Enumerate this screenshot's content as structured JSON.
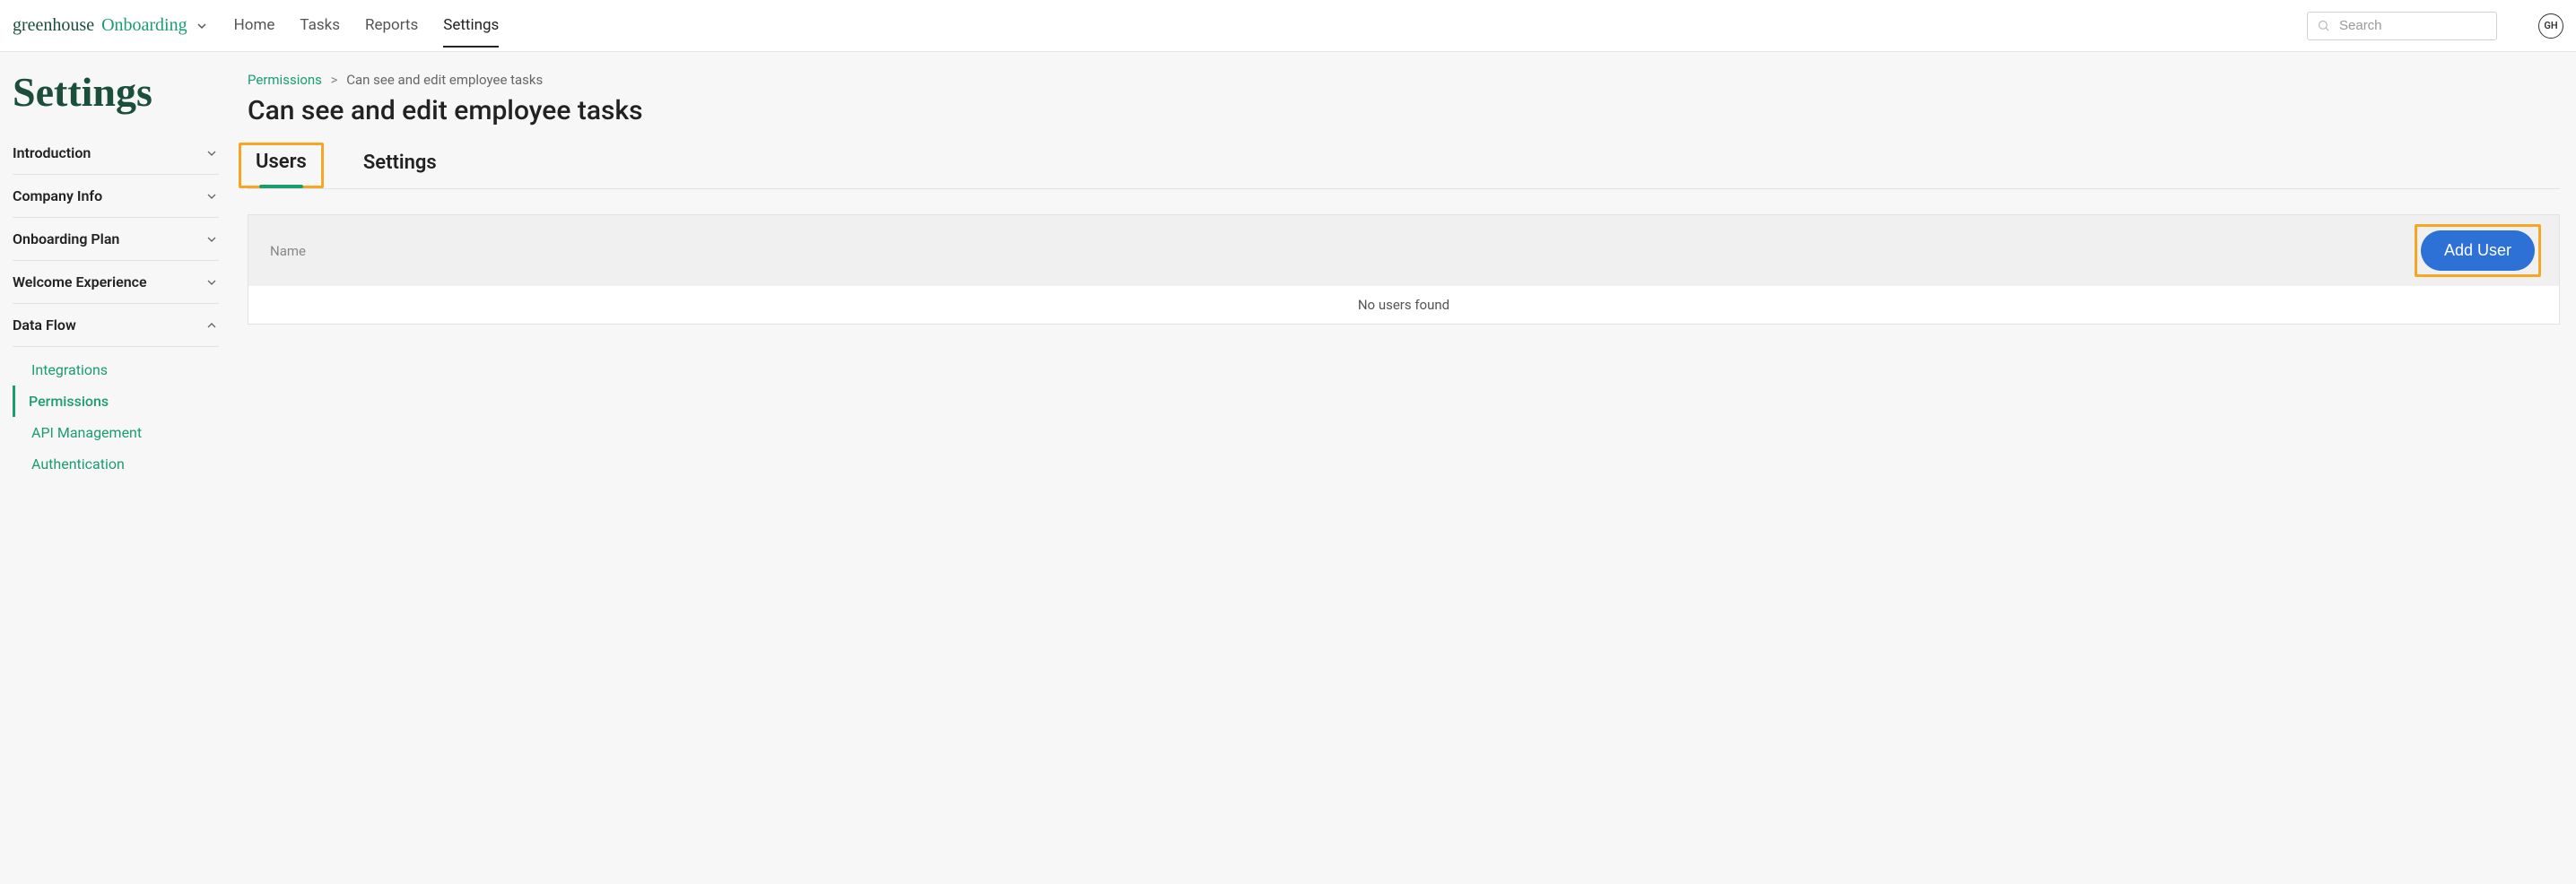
{
  "brand": {
    "main": "greenhouse",
    "sub": "Onboarding"
  },
  "nav": {
    "items": [
      {
        "label": "Home",
        "active": false
      },
      {
        "label": "Tasks",
        "active": false
      },
      {
        "label": "Reports",
        "active": false
      },
      {
        "label": "Settings",
        "active": true
      }
    ]
  },
  "search": {
    "placeholder": "Search"
  },
  "avatar": {
    "initials": "GH"
  },
  "page_title": "Settings",
  "sidebar": {
    "sections": [
      {
        "label": "Introduction",
        "open": false
      },
      {
        "label": "Company Info",
        "open": false
      },
      {
        "label": "Onboarding Plan",
        "open": false
      },
      {
        "label": "Welcome Experience",
        "open": false
      },
      {
        "label": "Data Flow",
        "open": true,
        "items": [
          {
            "label": "Integrations",
            "active": false
          },
          {
            "label": "Permissions",
            "active": true
          },
          {
            "label": "API Management",
            "active": false
          },
          {
            "label": "Authentication",
            "active": false
          }
        ]
      }
    ]
  },
  "breadcrumb": {
    "root": "Permissions",
    "sep": ">",
    "leaf": "Can see and edit employee tasks"
  },
  "main_title": "Can see and edit employee tasks",
  "tabs": [
    {
      "label": "Users",
      "active": true
    },
    {
      "label": "Settings",
      "active": false
    }
  ],
  "table": {
    "header": "Name",
    "add_button": "Add User",
    "empty": "No users found"
  }
}
